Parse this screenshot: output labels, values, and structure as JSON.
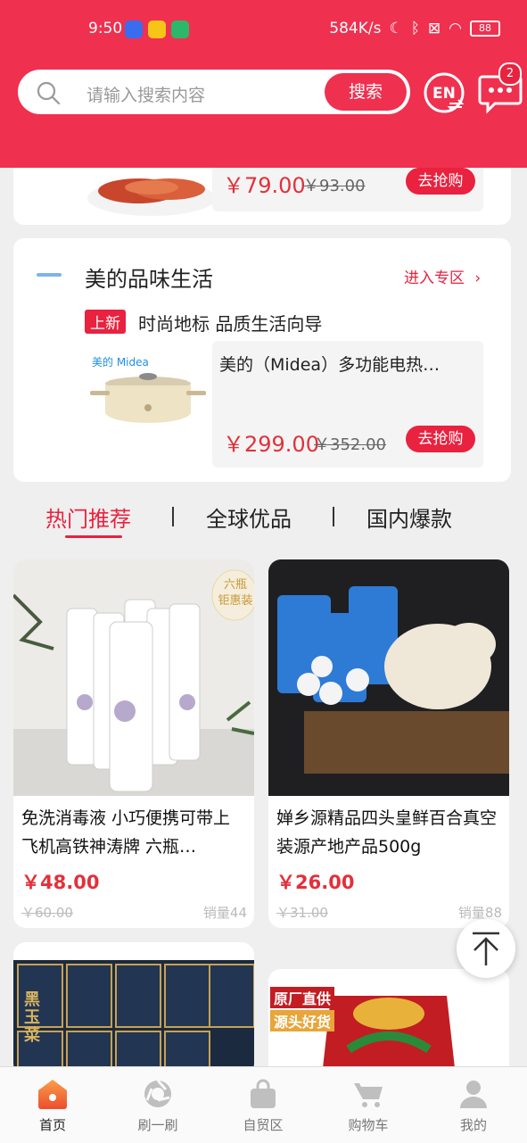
{
  "status_bar": {
    "time": "9:50",
    "speed": "584K/s",
    "battery": "88"
  },
  "search": {
    "placeholder": "请输入搜索内容",
    "button": "搜索"
  },
  "header": {
    "lang_button": "EN",
    "message_count": "2"
  },
  "top_card": {
    "price": "￥79.00",
    "old_price": "￥93.00",
    "button": "去抢购"
  },
  "zone_card": {
    "title": "美的品味生活",
    "enter_link": "进入专区",
    "tag": "上新",
    "subtitle": "时尚地标 品质生活向导",
    "brand_logo": "美的 Midea",
    "product_title": "美的（Midea）多功能电热…",
    "price": "￥299.00",
    "old_price": "￥352.00",
    "button": "去抢购"
  },
  "tabs": [
    "热门推荐",
    "全球优品",
    "国内爆款"
  ],
  "products": [
    {
      "title": "免洗消毒液 小巧便携可带上飞机高铁神涛牌 六瓶…",
      "price": "￥48.00",
      "old_price": "￥60.00",
      "sales": "销量44",
      "img_badge": "六瓶\n钜惠装"
    },
    {
      "title": "婵乡源精品四头皇鲜百合真空装源产地产品500g",
      "price": "￥26.00",
      "old_price": "￥31.00",
      "sales": "销量88"
    }
  ],
  "products_row2": [
    {
      "img_text": "黑玉菜"
    },
    {
      "badge_line1": "原厂直供",
      "badge_line2": "源头好货"
    }
  ],
  "bottom_nav": [
    {
      "label": "首页",
      "icon": "home-icon",
      "active": true
    },
    {
      "label": "刷一刷",
      "icon": "refresh-icon"
    },
    {
      "label": "自贸区",
      "icon": "bag-icon"
    },
    {
      "label": "购物车",
      "icon": "cart-icon"
    },
    {
      "label": "我的",
      "icon": "user-icon"
    }
  ],
  "colors": {
    "brand": "#f0304f",
    "price": "#e3303a"
  }
}
